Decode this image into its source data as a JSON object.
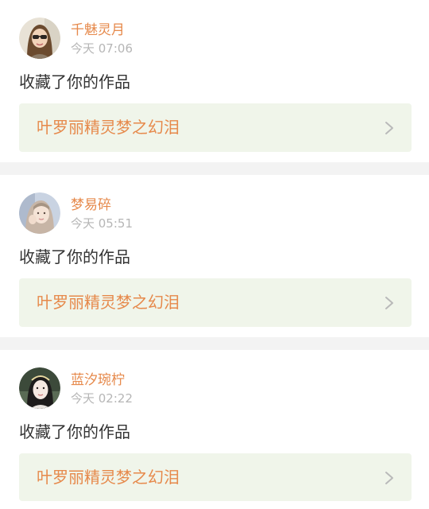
{
  "feed": {
    "items": [
      {
        "user_name": "千魅灵月",
        "time": "今天 07:06",
        "action": "收藏了你的作品",
        "work_title": "叶罗丽精灵梦之幻泪",
        "avatar_icon": "user-avatar-icon"
      },
      {
        "user_name": "梦易碎",
        "time": "今天 05:51",
        "action": "收藏了你的作品",
        "work_title": "叶罗丽精灵梦之幻泪",
        "avatar_icon": "user-avatar-icon"
      },
      {
        "user_name": "蓝汐琬柠",
        "time": "今天 02:22",
        "action": "收藏了你的作品",
        "work_title": "叶罗丽精灵梦之幻泪",
        "avatar_icon": "user-avatar-icon"
      }
    ],
    "chevron_icon": "chevron-right-icon"
  },
  "colors": {
    "accent": "#e6894b",
    "timestamp": "#b6b6b6",
    "work_link_bg": "#f0f5ea",
    "separator": "#f3f3f3"
  }
}
